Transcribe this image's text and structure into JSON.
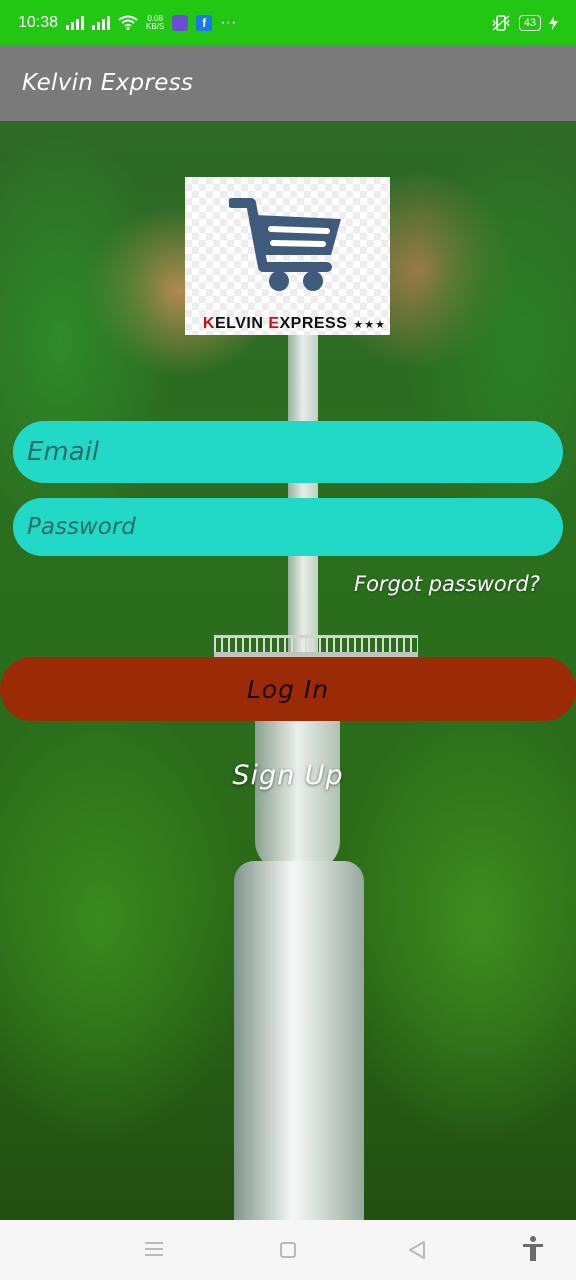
{
  "status_bar": {
    "time": "10:38",
    "net_speed": "0.08",
    "net_unit": "KB/S",
    "more": "···",
    "battery": "43",
    "icons": [
      "signal-icon",
      "signal-icon",
      "wifi-icon",
      "app-notification-icon",
      "facebook-icon",
      "vibrate-icon",
      "battery-icon",
      "charging-icon"
    ]
  },
  "app_bar": {
    "title": "Kelvin Express"
  },
  "logo": {
    "brand_text": "KELVIN EXPRESS",
    "stars": "★★★",
    "cart_color": "#3f5a7a",
    "accent_color": "#c0131b"
  },
  "form": {
    "email_placeholder": "Email",
    "password_placeholder": "Password",
    "forgot_label": "Forgot password?",
    "login_label": "Log In",
    "signup_label": "Sign Up"
  },
  "colors": {
    "status_bar": "#22c714",
    "app_bar": "#7a7a7a",
    "input_fill": "#22d8c6",
    "login_fill": "#9b2b07"
  },
  "nav_bar": {
    "icons": [
      "menu-icon",
      "home-icon",
      "back-icon",
      "accessibility-icon"
    ]
  }
}
